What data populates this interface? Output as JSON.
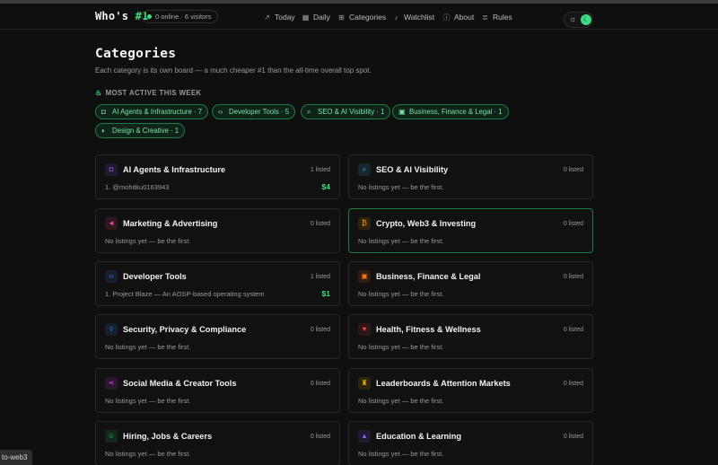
{
  "header": {
    "brand_main": "Who's ",
    "brand_accent": "#1",
    "presence": "0 online · 6 visitors",
    "nav": [
      {
        "label": "Today",
        "icon": "trending-up-icon"
      },
      {
        "label": "Daily",
        "icon": "calendar-icon"
      },
      {
        "label": "Categories",
        "icon": "grid-icon"
      },
      {
        "label": "Watchlist",
        "icon": "bell-icon"
      },
      {
        "label": "About",
        "icon": "info-icon"
      },
      {
        "label": "Rules",
        "icon": "list-icon"
      }
    ]
  },
  "page": {
    "title": "Categories",
    "subtitle": "Each category is its own board — a much cheaper #1 than the all-time overall top spot.",
    "active_title": "MOST ACTIVE THIS WEEK"
  },
  "chips": [
    {
      "label": "AI Agents & Infrastructure · 7",
      "icon": "robot-icon"
    },
    {
      "label": "Developer Tools · 5",
      "icon": "code-icon"
    },
    {
      "label": "SEO & AI Visibility · 1",
      "icon": "search-icon"
    },
    {
      "label": "Business, Finance & Legal · 1",
      "icon": "briefcase-icon"
    },
    {
      "label": "Design & Creative · 1",
      "icon": "palette-icon"
    }
  ],
  "categories": [
    {
      "title": "AI Agents & Infrastructure",
      "count": "1 listed",
      "desc": "1. @mohitku0163943",
      "price": "$4",
      "icon": "robot-icon",
      "color": "#8b5cf6"
    },
    {
      "title": "SEO & AI Visibility",
      "count": "0 listed",
      "desc": "No listings yet — be the first.",
      "price": "",
      "icon": "search-icon",
      "color": "#38bdf8"
    },
    {
      "title": "Marketing & Advertising",
      "count": "0 listed",
      "desc": "No listings yet — be the first.",
      "price": "",
      "icon": "megaphone-icon",
      "color": "#ec4899"
    },
    {
      "title": "Crypto, Web3 & Investing",
      "count": "0 listed",
      "desc": "No listings yet — be the first.",
      "price": "",
      "icon": "bitcoin-icon",
      "color": "#f59e0b"
    },
    {
      "title": "Developer Tools",
      "count": "1 listed",
      "desc": "1. Project Blaze — An AOSP-based operating system",
      "price": "$1",
      "icon": "code-icon",
      "color": "#3b82f6"
    },
    {
      "title": "Business, Finance & Legal",
      "count": "0 listed",
      "desc": "No listings yet — be the first.",
      "price": "",
      "icon": "briefcase-icon",
      "color": "#f97316"
    },
    {
      "title": "Security, Privacy & Compliance",
      "count": "0 listed",
      "desc": "No listings yet — be the first.",
      "price": "",
      "icon": "shield-icon",
      "color": "#3b82f6"
    },
    {
      "title": "Health, Fitness & Wellness",
      "count": "0 listed",
      "desc": "No listings yet — be the first.",
      "price": "",
      "icon": "heart-icon",
      "color": "#ef4444"
    },
    {
      "title": "Social Media & Creator Tools",
      "count": "0 listed",
      "desc": "No listings yet — be the first.",
      "price": "",
      "icon": "share-icon",
      "color": "#d946ef"
    },
    {
      "title": "Leaderboards & Attention Markets",
      "count": "0 listed",
      "desc": "No listings yet — be the first.",
      "price": "",
      "icon": "trophy-icon",
      "color": "#eab308"
    },
    {
      "title": "Hiring, Jobs & Careers",
      "count": "0 listed",
      "desc": "No listings yet — be the first.",
      "price": "",
      "icon": "users-icon",
      "color": "#22c55e"
    },
    {
      "title": "Education & Learning",
      "count": "0 listed",
      "desc": "No listings yet — be the first.",
      "price": "",
      "icon": "graduation-cap-icon",
      "color": "#8b5cf6"
    }
  ],
  "status_tooltip": "to-web3",
  "colors": {
    "accent": "#3ddc84",
    "background": "#0f0f0f",
    "card_border": "#262626"
  }
}
